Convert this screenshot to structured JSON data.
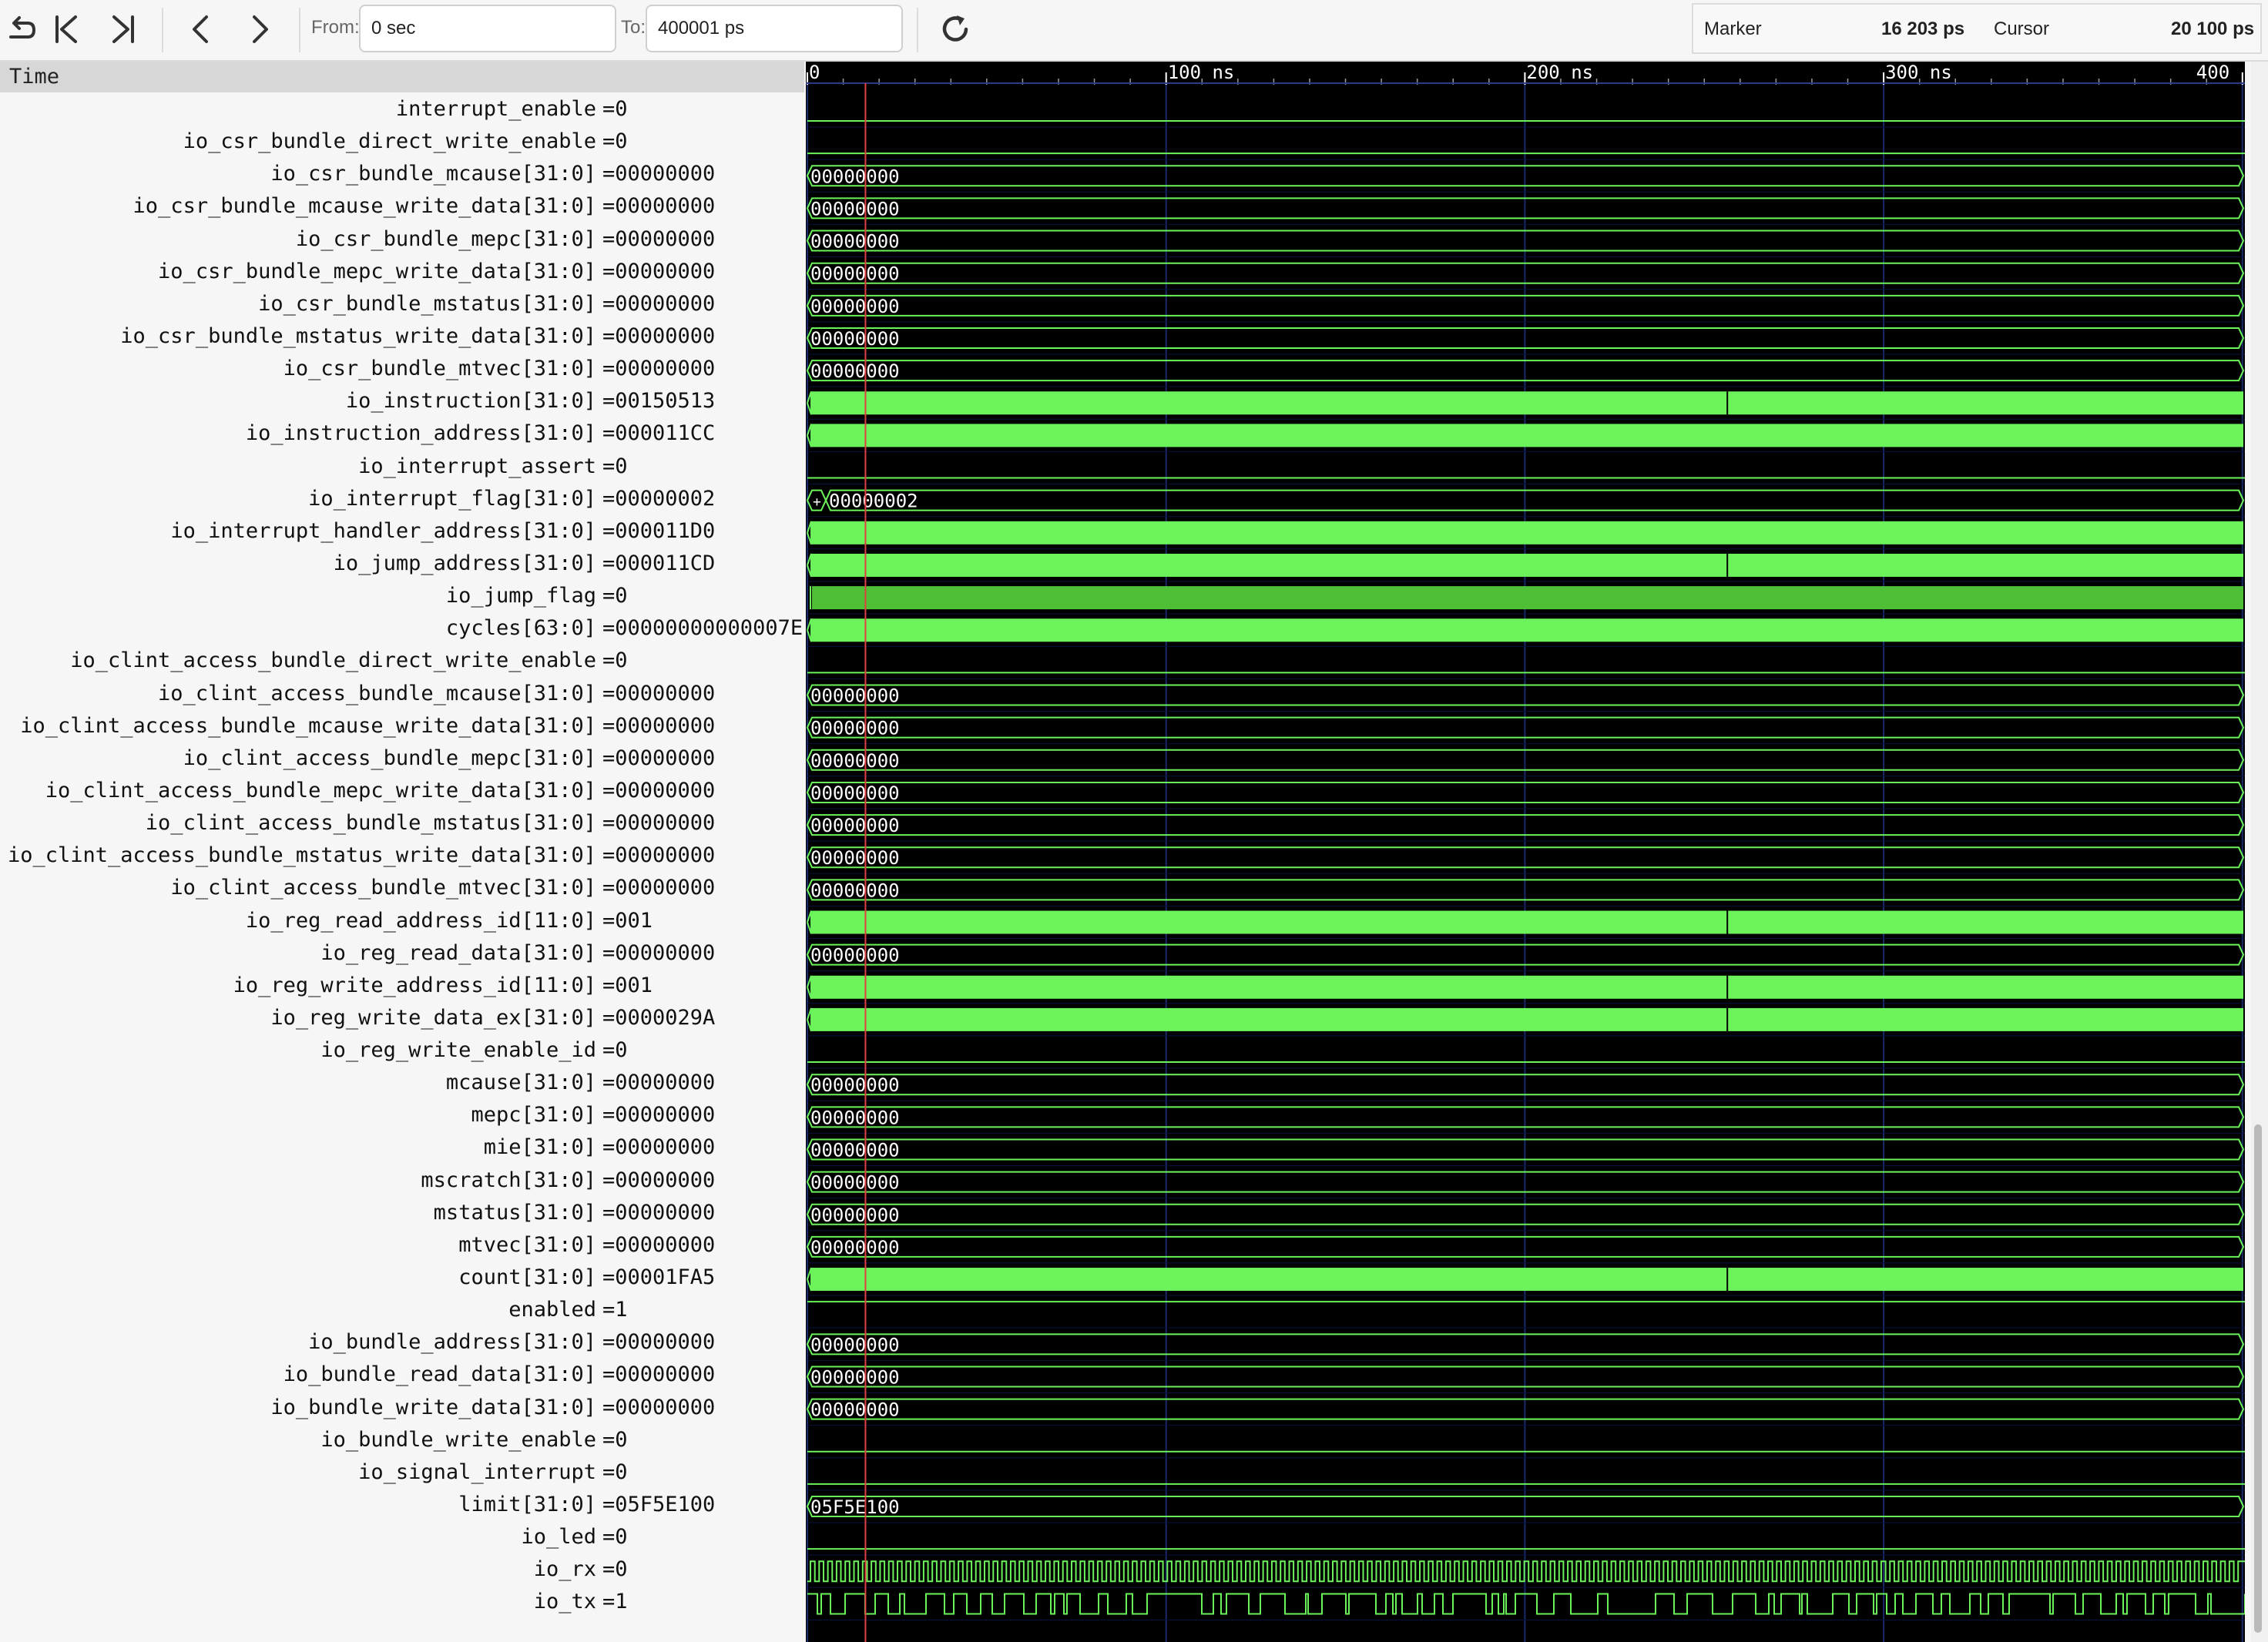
{
  "toolbar": {
    "from_label": "From:",
    "from_value": "0 sec",
    "to_label": "To:",
    "to_value": "400001 ps",
    "marker_label": "Marker",
    "marker_value": "16 203 ps",
    "cursor_label": "Cursor",
    "cursor_value": "20 100 ps"
  },
  "names_header": "Time",
  "timeline": {
    "ticks": [
      "0",
      "100 ns",
      "200 ns",
      "300 ns",
      "400"
    ]
  },
  "colors": {
    "wave_bg": "#000000",
    "signal": "#6cf25a",
    "cursor": "#e04040",
    "grid": "#1a2a6a"
  },
  "signals": [
    {
      "name": "interrupt_enable",
      "value": "=0",
      "kind": "bit",
      "level": 0
    },
    {
      "name": "io_csr_bundle_direct_write_enable",
      "value": "=0",
      "kind": "bit",
      "level": 0
    },
    {
      "name": "io_csr_bundle_mcause[31:0]",
      "value": "=00000000",
      "kind": "bus",
      "label": "00000000"
    },
    {
      "name": "io_csr_bundle_mcause_write_data[31:0]",
      "value": "=00000000",
      "kind": "bus",
      "label": "00000000"
    },
    {
      "name": "io_csr_bundle_mepc[31:0]",
      "value": "=00000000",
      "kind": "bus",
      "label": "00000000"
    },
    {
      "name": "io_csr_bundle_mepc_write_data[31:0]",
      "value": "=00000000",
      "kind": "bus",
      "label": "00000000"
    },
    {
      "name": "io_csr_bundle_mstatus[31:0]",
      "value": "=00000000",
      "kind": "bus",
      "label": "00000000"
    },
    {
      "name": "io_csr_bundle_mstatus_write_data[31:0]",
      "value": "=00000000",
      "kind": "bus",
      "label": "00000000"
    },
    {
      "name": "io_csr_bundle_mtvec[31:0]",
      "value": "=00000000",
      "kind": "bus",
      "label": "00000000"
    },
    {
      "name": "io_instruction[31:0]",
      "value": "=00150513",
      "kind": "dense",
      "split": true
    },
    {
      "name": "io_instruction_address[31:0]",
      "value": "=000011CC",
      "kind": "dense",
      "split": false
    },
    {
      "name": "io_interrupt_assert",
      "value": "=0",
      "kind": "bit",
      "level": 0
    },
    {
      "name": "io_interrupt_flag[31:0]",
      "value": "=00000002",
      "kind": "bus",
      "label": "00000002",
      "prefix": "+"
    },
    {
      "name": "io_interrupt_handler_address[31:0]",
      "value": "=000011D0",
      "kind": "dense",
      "split": false
    },
    {
      "name": "io_jump_address[31:0]",
      "value": "=000011CD",
      "kind": "dense",
      "split": true
    },
    {
      "name": "io_jump_flag",
      "value": "=0",
      "kind": "densebit"
    },
    {
      "name": "cycles[63:0]",
      "value": "=00000000000007E",
      "kind": "dense",
      "split": false
    },
    {
      "name": "io_clint_access_bundle_direct_write_enable",
      "value": "=0",
      "kind": "bit",
      "level": 0
    },
    {
      "name": "io_clint_access_bundle_mcause[31:0]",
      "value": "=00000000",
      "kind": "bus",
      "label": "00000000"
    },
    {
      "name": "io_clint_access_bundle_mcause_write_data[31:0]",
      "value": "=00000000",
      "kind": "bus",
      "label": "00000000"
    },
    {
      "name": "io_clint_access_bundle_mepc[31:0]",
      "value": "=00000000",
      "kind": "bus",
      "label": "00000000"
    },
    {
      "name": "io_clint_access_bundle_mepc_write_data[31:0]",
      "value": "=00000000",
      "kind": "bus",
      "label": "00000000"
    },
    {
      "name": "io_clint_access_bundle_mstatus[31:0]",
      "value": "=00000000",
      "kind": "bus",
      "label": "00000000"
    },
    {
      "name": "io_clint_access_bundle_mstatus_write_data[31:0]",
      "value": "=00000000",
      "kind": "bus",
      "label": "00000000"
    },
    {
      "name": "io_clint_access_bundle_mtvec[31:0]",
      "value": "=00000000",
      "kind": "bus",
      "label": "00000000"
    },
    {
      "name": "io_reg_read_address_id[11:0]",
      "value": "=001",
      "kind": "dense",
      "split": true
    },
    {
      "name": "io_reg_read_data[31:0]",
      "value": "=00000000",
      "kind": "bus",
      "label": "00000000"
    },
    {
      "name": "io_reg_write_address_id[11:0]",
      "value": "=001",
      "kind": "dense",
      "split": true
    },
    {
      "name": "io_reg_write_data_ex[31:0]",
      "value": "=0000029A",
      "kind": "dense",
      "split": true
    },
    {
      "name": "io_reg_write_enable_id",
      "value": "=0",
      "kind": "bit",
      "level": 0
    },
    {
      "name": "mcause[31:0]",
      "value": "=00000000",
      "kind": "bus",
      "label": "00000000"
    },
    {
      "name": "mepc[31:0]",
      "value": "=00000000",
      "kind": "bus",
      "label": "00000000"
    },
    {
      "name": "mie[31:0]",
      "value": "=00000000",
      "kind": "bus",
      "label": "00000000"
    },
    {
      "name": "mscratch[31:0]",
      "value": "=00000000",
      "kind": "bus",
      "label": "00000000"
    },
    {
      "name": "mstatus[31:0]",
      "value": "=00000000",
      "kind": "bus",
      "label": "00000000"
    },
    {
      "name": "mtvec[31:0]",
      "value": "=00000000",
      "kind": "bus",
      "label": "00000000"
    },
    {
      "name": "count[31:0]",
      "value": "=00001FA5",
      "kind": "dense",
      "split": true
    },
    {
      "name": "enabled",
      "value": "=1",
      "kind": "bit",
      "level": 1
    },
    {
      "name": "io_bundle_address[31:0]",
      "value": "=00000000",
      "kind": "bus",
      "label": "00000000"
    },
    {
      "name": "io_bundle_read_data[31:0]",
      "value": "=00000000",
      "kind": "bus",
      "label": "00000000"
    },
    {
      "name": "io_bundle_write_data[31:0]",
      "value": "=00000000",
      "kind": "bus",
      "label": "00000000"
    },
    {
      "name": "io_bundle_write_enable",
      "value": "=0",
      "kind": "bit",
      "level": 0
    },
    {
      "name": "io_signal_interrupt",
      "value": "=0",
      "kind": "bit",
      "level": 0
    },
    {
      "name": "limit[31:0]",
      "value": "=05F5E100",
      "kind": "bus",
      "label": "05F5E100"
    },
    {
      "name": "io_led",
      "value": "=0",
      "kind": "bit",
      "level": 0
    },
    {
      "name": "io_rx",
      "value": "=0",
      "kind": "clock"
    },
    {
      "name": "io_tx",
      "value": "=1",
      "kind": "serial"
    }
  ]
}
